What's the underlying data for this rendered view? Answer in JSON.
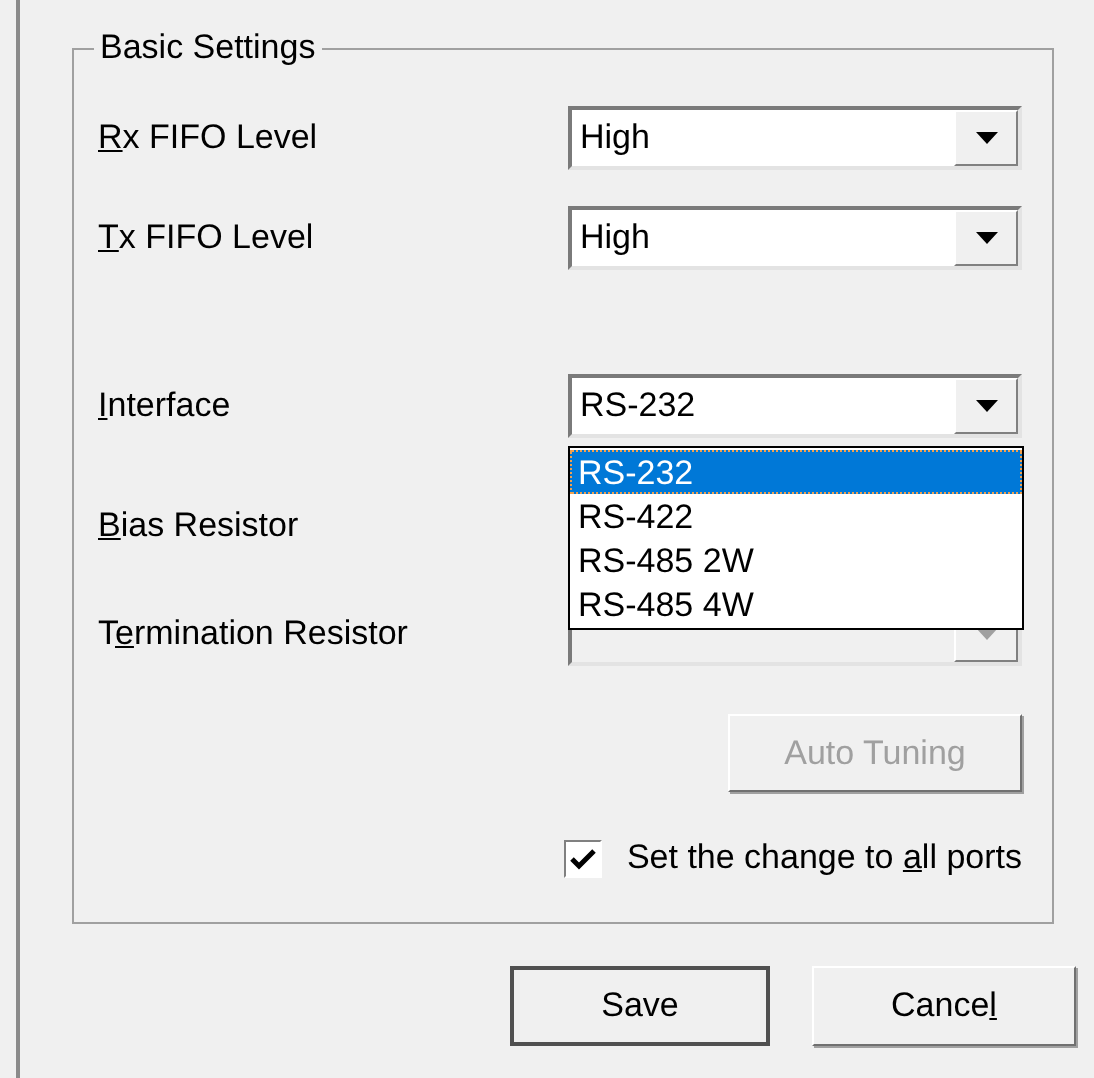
{
  "group": {
    "title": "Basic Settings",
    "fields": [
      {
        "kind": "dropdown",
        "label": {
          "key": "R",
          "after": "x FIFO Level"
        },
        "value": "High",
        "disabled": false
      },
      {
        "kind": "dropdown",
        "label": {
          "key": "T",
          "after": "x FIFO Level"
        },
        "value": "High",
        "disabled": false
      },
      {
        "kind": "dropdown",
        "label": {
          "key": "I",
          "after": "nterface"
        },
        "value": "RS-232",
        "disabled": false,
        "expanded": true,
        "options": [
          {
            "label": "RS-232",
            "selected": true
          },
          {
            "label": "RS-422",
            "selected": false
          },
          {
            "label": "RS-485 2W",
            "selected": false
          },
          {
            "label": "RS-485 4W",
            "selected": false
          }
        ]
      },
      {
        "kind": "label",
        "label": {
          "key": "B",
          "after": "ias Resistor"
        }
      },
      {
        "kind": "dropdown",
        "label": {
          "before": "T",
          "key": "e",
          "after": "rmination Resistor"
        },
        "disabled": true
      }
    ],
    "auto_tuning": {
      "label": "Auto Tuning",
      "disabled": true
    },
    "apply_all": {
      "label": {
        "before": "Set the change to ",
        "key": "a",
        "after": "ll ports"
      },
      "checked": true
    }
  },
  "buttons": [
    {
      "label": {
        "before": "Save"
      }
    },
    {
      "label": {
        "before": "Cance",
        "key": "l"
      }
    }
  ]
}
